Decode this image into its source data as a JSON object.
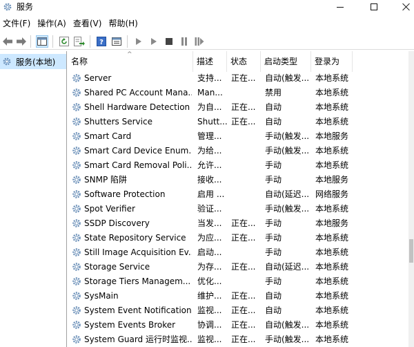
{
  "window": {
    "title": "服务"
  },
  "menu": [
    "文件(F)",
    "操作(A)",
    "查看(V)",
    "帮助(H)"
  ],
  "toolbar": {
    "icons": [
      "back-arrow-icon",
      "forward-arrow-icon",
      "console-tree-icon",
      "refresh-icon",
      "export-list-icon",
      "help-icon",
      "properties-pane-icon",
      "play-icon",
      "play-paused-icon",
      "stop-icon",
      "pause-icon",
      "restart-icon"
    ]
  },
  "tree": {
    "item_label": "服务(本地)"
  },
  "columns": [
    "名称",
    "描述",
    "状态",
    "启动类型",
    "登录为"
  ],
  "services": [
    {
      "name": "Server",
      "desc": "支持...",
      "status": "正在...",
      "startup": "自动(触发...",
      "logon": "本地系统"
    },
    {
      "name": "Shared PC Account Mana...",
      "desc": "Man...",
      "status": "",
      "startup": "禁用",
      "logon": "本地系统"
    },
    {
      "name": "Shell Hardware Detection",
      "desc": "为自...",
      "status": "正在...",
      "startup": "自动",
      "logon": "本地系统"
    },
    {
      "name": "Shutters Service",
      "desc": "Shutt...",
      "status": "正在...",
      "startup": "自动",
      "logon": "本地系统"
    },
    {
      "name": "Smart Card",
      "desc": "管理...",
      "status": "",
      "startup": "手动(触发...",
      "logon": "本地服务"
    },
    {
      "name": "Smart Card Device Enum...",
      "desc": "为给...",
      "status": "",
      "startup": "手动(触发...",
      "logon": "本地系统"
    },
    {
      "name": "Smart Card Removal Poli...",
      "desc": "允许...",
      "status": "",
      "startup": "手动",
      "logon": "本地系统"
    },
    {
      "name": "SNMP 陷阱",
      "desc": "接收...",
      "status": "",
      "startup": "手动",
      "logon": "本地服务"
    },
    {
      "name": "Software Protection",
      "desc": "启用 ...",
      "status": "",
      "startup": "自动(延迟...",
      "logon": "网络服务"
    },
    {
      "name": "Spot Verifier",
      "desc": "验证...",
      "status": "",
      "startup": "手动(触发...",
      "logon": "本地系统"
    },
    {
      "name": "SSDP Discovery",
      "desc": "当发...",
      "status": "正在...",
      "startup": "手动",
      "logon": "本地服务"
    },
    {
      "name": "State Repository Service",
      "desc": "为应...",
      "status": "正在...",
      "startup": "手动",
      "logon": "本地系统"
    },
    {
      "name": "Still Image Acquisition Ev...",
      "desc": "启动...",
      "status": "",
      "startup": "手动",
      "logon": "本地系统"
    },
    {
      "name": "Storage Service",
      "desc": "为存...",
      "status": "正在...",
      "startup": "自动(延迟...",
      "logon": "本地系统"
    },
    {
      "name": "Storage Tiers Managem...",
      "desc": "优化...",
      "status": "",
      "startup": "手动",
      "logon": "本地系统"
    },
    {
      "name": "SysMain",
      "desc": "维护...",
      "status": "正在...",
      "startup": "自动",
      "logon": "本地系统"
    },
    {
      "name": "System Event Notification...",
      "desc": "监视...",
      "status": "正在...",
      "startup": "自动",
      "logon": "本地系统"
    },
    {
      "name": "System Events Broker",
      "desc": "协调...",
      "status": "正在...",
      "startup": "自动(触发...",
      "logon": "本地系统"
    },
    {
      "name": "System Guard 运行时监视...",
      "desc": "监视...",
      "status": "正在...",
      "startup": "手动(触发...",
      "logon": "本地系统"
    }
  ],
  "colors": {
    "selection": "#cde8ff",
    "gear": "#5b7fa6"
  }
}
